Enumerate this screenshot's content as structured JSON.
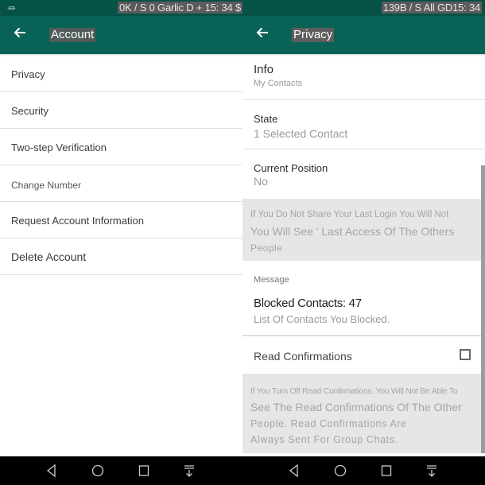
{
  "left_screen": {
    "status_bar": {
      "usb_icon": "usb-icon",
      "text": "0K / S 0 Garlic D + 15: 34 $"
    },
    "app_bar": {
      "back_icon": "arrow-left-icon",
      "title": "Account"
    },
    "menu_items": [
      {
        "label": "Privacy"
      },
      {
        "label": "Security"
      },
      {
        "label": "Two-step Verification"
      },
      {
        "label": "Change Number"
      },
      {
        "label": "Request Account Information"
      },
      {
        "label": "Delete Account"
      }
    ]
  },
  "right_screen": {
    "status_bar": {
      "text": "139B / S All GD15: 34"
    },
    "app_bar": {
      "back_icon": "arrow-left-icon",
      "title": "Privacy"
    },
    "settings": {
      "info": {
        "title": "Info",
        "value": "My Contacts"
      },
      "state": {
        "title": "State",
        "value": "1 Selected Contact"
      },
      "current_position": {
        "title": "Current Position",
        "value": "No"
      },
      "last_login_note": {
        "line1": "If You Do Not Share Your Last Login You Will Not",
        "line2": "You Will See ' Last Access Of The Others",
        "line3": "People"
      },
      "message_header": "Message",
      "blocked_contacts": {
        "title": "Blocked Contacts: 47",
        "subtitle": "List Of Contacts You Blocked."
      },
      "read_confirmations": {
        "title": "Read Confirmations",
        "checked": false
      },
      "read_confirmations_note": {
        "line1": "If You Turn Off Read Confirmations. You Will Not Be Able To",
        "line2": "See The Read Confirmations Of The Other",
        "line3": "People. Read Confirmations Are",
        "line4": "Always Sent For Group Chats."
      }
    }
  },
  "nav_bar": {
    "buttons": [
      "back-triangle-icon",
      "home-circle-icon",
      "recents-square-icon",
      "notification-pull-icon"
    ]
  },
  "colors": {
    "status_bar": "#055246",
    "app_bar": "#086356",
    "note_background": "#e6e6e6"
  }
}
